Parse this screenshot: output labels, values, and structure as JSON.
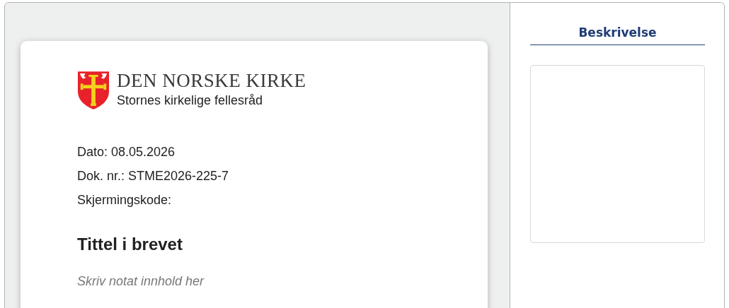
{
  "letter": {
    "organization": "DEN NORSKE KIRKE",
    "unit": "Stornes kirkelige fellesråd",
    "meta": [
      "Dato: 08.05.2026",
      "Dok. nr.: STME2026-225-7",
      "Skjermingskode:"
    ],
    "title": "Tittel i brevet",
    "body_placeholder": "Skriv notat innhold her"
  },
  "side_panel": {
    "heading": "Beskrivelse"
  }
}
